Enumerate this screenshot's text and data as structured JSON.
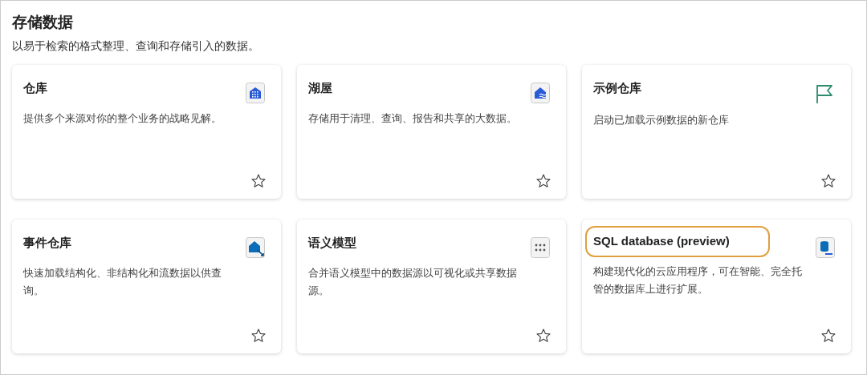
{
  "section": {
    "title": "存储数据",
    "subtitle": "以易于检索的格式整理、查询和存储引入的数据。"
  },
  "cards": [
    {
      "title": "仓库",
      "description": "提供多个来源对你的整个业务的战略见解。",
      "kind": "warehouse",
      "favorite": false,
      "highlighted": false
    },
    {
      "title": "湖屋",
      "description": "存储用于清理、查询、报告和共享的大数据。",
      "kind": "lakehouse",
      "favorite": false,
      "highlighted": false
    },
    {
      "title": "示例仓库",
      "description": "启动已加载示例数据的新仓库",
      "kind": "flag",
      "favorite": false,
      "highlighted": false
    },
    {
      "title": "事件仓库",
      "description": "快速加载结构化、非结构化和流数据以供查询。",
      "kind": "eventhouse",
      "favorite": false,
      "highlighted": false
    },
    {
      "title": "语义模型",
      "description": "合并语义模型中的数据源以可视化或共享数据源。",
      "kind": "model",
      "favorite": false,
      "highlighted": false
    },
    {
      "title": "SQL database (preview)",
      "description": "构建现代化的云应用程序，可在智能、完全托管的数据库上进行扩展。",
      "kind": "sql",
      "favorite": false,
      "highlighted": true
    }
  ]
}
